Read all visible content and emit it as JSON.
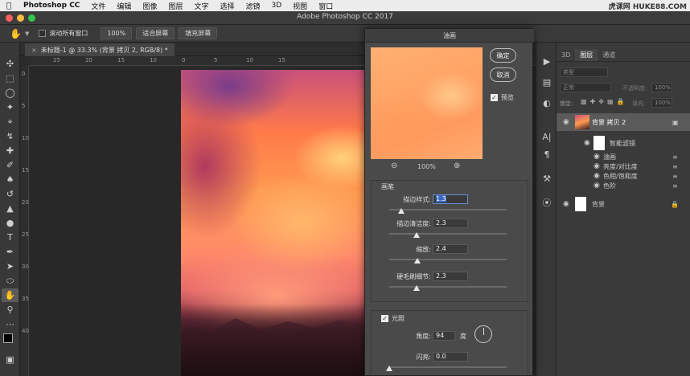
{
  "menubar": {
    "app": "Photoshop CC",
    "items": [
      "文件",
      "编辑",
      "图像",
      "图层",
      "文字",
      "选择",
      "滤镜",
      "3D",
      "视图",
      "窗口"
    ],
    "watermark": "虎课网 HUKE88.COM"
  },
  "window": {
    "title": "Adobe Photoshop CC 2017"
  },
  "options": {
    "scroll_all": "滚动所有窗口",
    "zoom": "100%",
    "fit_screen": "适合屏幕",
    "fill_screen": "填充屏幕"
  },
  "document": {
    "tab": "未标题-1 @ 33.3% (背景 拷贝 2, RGB/8) *",
    "ruler_h": [
      "25",
      "20",
      "15",
      "10",
      "5",
      "0",
      "5",
      "10",
      "15"
    ],
    "ruler_v": [
      "0",
      "5",
      "10",
      "15",
      "20",
      "25",
      "30",
      "35",
      "40"
    ]
  },
  "dialog": {
    "title": "油画",
    "ok": "确定",
    "cancel": "取消",
    "preview_label": "预览",
    "zoom": "100%",
    "brush_section": "画笔",
    "stylization_label": "描边样式:",
    "stylization_value": "1.3",
    "stylization_level": 0.1,
    "cleanliness_label": "描边清洁度:",
    "cleanliness_value": "2.3",
    "cleanliness_level": 0.23,
    "scale_label": "缩放:",
    "scale_value": "2.4",
    "scale_level": 0.24,
    "bristle_label": "硬毛刷细节:",
    "bristle_value": "2.3",
    "bristle_level": 0.23,
    "light_section": "光照",
    "angle_label": "角度:",
    "angle_value": "94",
    "angle_unit": "度",
    "shine_label": "闪亮:",
    "shine_value": "0.0",
    "shine_level": 0
  },
  "layers_panel": {
    "tabs": [
      "3D",
      "图层",
      "通道"
    ],
    "kind": "类型",
    "blend": "正常",
    "opacity_label": "不透明度:",
    "opacity_value": "100%",
    "lock_label": "锁定:",
    "fill_label": "填充:",
    "fill_value": "100%",
    "layers": [
      {
        "name": "背景 拷贝 2"
      },
      {
        "name": "智能滤镜"
      },
      {
        "name": "油画"
      },
      {
        "name": "亮度/对比度"
      },
      {
        "name": "色相/饱和度"
      },
      {
        "name": "色阶"
      },
      {
        "name": "背景"
      }
    ]
  },
  "colors": {
    "accent_select": "#3a68c4",
    "close": "#fc605c",
    "minimize": "#fdbc40",
    "maximize": "#34c84a"
  }
}
